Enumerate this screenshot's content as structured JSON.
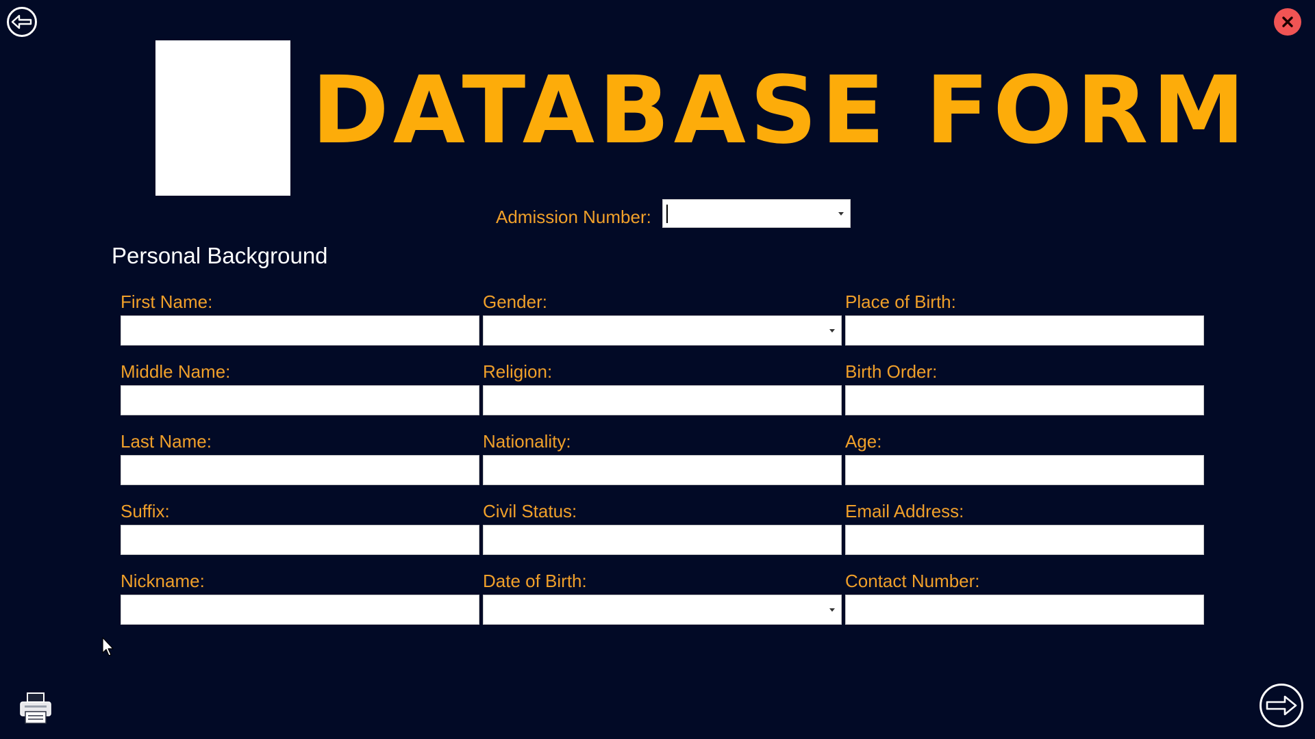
{
  "header": {
    "title": "DATABASE FORM"
  },
  "admission": {
    "label": "Admission Number:",
    "value": ""
  },
  "section": {
    "title": "Personal Background"
  },
  "fields": {
    "first_name": {
      "label": "First Name:",
      "value": ""
    },
    "gender": {
      "label": "Gender:",
      "value": ""
    },
    "place_of_birth": {
      "label": "Place of Birth:",
      "value": ""
    },
    "middle_name": {
      "label": "Middle Name:",
      "value": ""
    },
    "religion": {
      "label": "Religion:",
      "value": ""
    },
    "birth_order": {
      "label": "Birth Order:",
      "value": ""
    },
    "last_name": {
      "label": "Last Name:",
      "value": ""
    },
    "nationality": {
      "label": "Nationality:",
      "value": ""
    },
    "age": {
      "label": "Age:",
      "value": ""
    },
    "suffix": {
      "label": "Suffix:",
      "value": ""
    },
    "civil_status": {
      "label": "Civil Status:",
      "value": ""
    },
    "email_address": {
      "label": "Email Address:",
      "value": ""
    },
    "nickname": {
      "label": "Nickname:",
      "value": ""
    },
    "date_of_birth": {
      "label": "Date of Birth:",
      "value": ""
    },
    "contact_number": {
      "label": "Contact Number:",
      "value": ""
    }
  },
  "icons": {
    "back": "arrow-left-circle-icon",
    "close": "close-icon",
    "next": "arrow-right-circle-icon",
    "print": "printer-icon",
    "cursor": "mouse-pointer-icon"
  },
  "colors": {
    "background": "#020a26",
    "title": "#fdac0a",
    "label": "#f0a02a",
    "close": "#f05454",
    "input": "#ffffff"
  }
}
